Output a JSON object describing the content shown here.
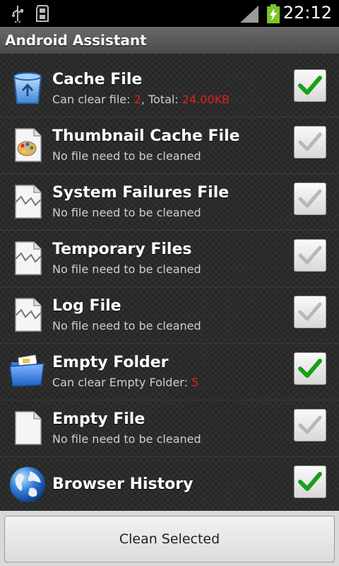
{
  "status_bar": {
    "time": "22:12",
    "icons": [
      "usb-icon",
      "sdcard-icon",
      "signal-icon",
      "battery-charging-icon"
    ]
  },
  "title_bar": {
    "title": "Android Assistant"
  },
  "items": [
    {
      "title": "Cache File",
      "sub_prefix": "Can clear file: ",
      "sub_count": "2",
      "sub_mid": ", Total: ",
      "sub_total": "24.00KB",
      "icon": "recycle-bin-icon",
      "checked": true
    },
    {
      "title": "Thumbnail Cache File",
      "subtitle": "No file need to be cleaned",
      "icon": "palette-file-icon",
      "checked": false
    },
    {
      "title": "System Failures File",
      "subtitle": "No file need to be cleaned",
      "icon": "broken-file-icon",
      "checked": false
    },
    {
      "title": "Temporary Files",
      "subtitle": "No file need to be cleaned",
      "icon": "broken-file-icon",
      "checked": false
    },
    {
      "title": "Log File",
      "subtitle": "No file need to be cleaned",
      "icon": "broken-file-icon",
      "checked": false
    },
    {
      "title": "Empty Folder",
      "sub_prefix": "Can clear Empty Folder: ",
      "sub_count": "5",
      "icon": "folder-icon",
      "checked": true
    },
    {
      "title": "Empty File",
      "subtitle": "No file need to be cleaned",
      "icon": "blank-file-icon",
      "checked": false
    },
    {
      "title": "Browser History",
      "icon": "globe-icon",
      "checked": true
    }
  ],
  "colors": {
    "highlight_red": "#e21f1f",
    "check_green": "#18a018",
    "check_gray": "#b0b0b0"
  },
  "footer": {
    "clean_button_label": "Clean Selected"
  }
}
